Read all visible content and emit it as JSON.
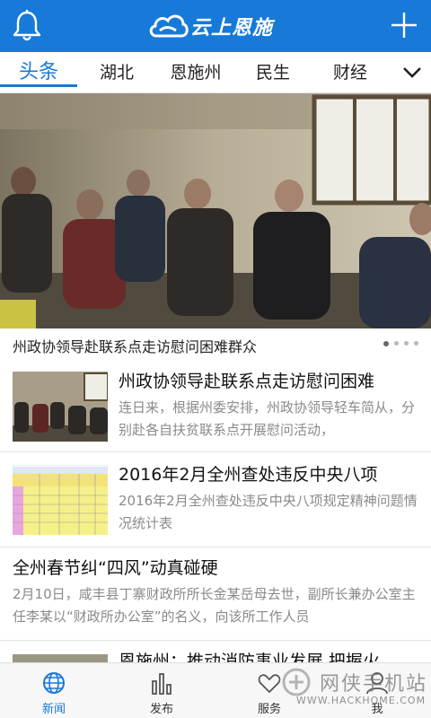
{
  "header": {
    "logo_text": "云上恩施",
    "brand_color": "#1779d8",
    "left_icon": "bell-icon",
    "right_icon": "plus-icon"
  },
  "tabs": [
    {
      "label": "头条",
      "active": true
    },
    {
      "label": "湖北",
      "active": false
    },
    {
      "label": "恩施州",
      "active": false
    },
    {
      "label": "民生",
      "active": false
    },
    {
      "label": "财经",
      "active": false
    }
  ],
  "banner": {
    "caption": "州政协领导赴联系点走访慰问困难群众",
    "slide_count": 4,
    "active_slide": 1
  },
  "news": [
    {
      "title": "州政协领导赴联系点走访慰问困难",
      "desc": "连日来，根据州委安排，州政协领导轻车简从，分别赴各自扶贫联系点开展慰问活动，"
    },
    {
      "title": "2016年2月全州查处违反中央八项",
      "desc": "2016年2月全州查处违反中央八项规定精神问题情况统计表"
    },
    {
      "title": "全州春节纠“四风”动真碰硬",
      "desc": "2月10日，咸丰县丁寨财政所所长金某岳母去世，副所长兼办公室主任李某以“财政所办公室”的名义，向该所工作人员"
    },
    {
      "title": "恩施州：推动消防事业发展 把握火"
    }
  ],
  "bottom_nav": [
    {
      "label": "新闻",
      "icon": "globe-icon",
      "active": true
    },
    {
      "label": "发布",
      "icon": "bar-chart-icon",
      "active": false
    },
    {
      "label": "服务",
      "icon": "heart-icon",
      "active": false
    },
    {
      "label": "我",
      "icon": "user-icon",
      "active": false
    }
  ],
  "watermark": {
    "text": "网侠手机站",
    "url": "WWW.HACKHOME.COM"
  }
}
